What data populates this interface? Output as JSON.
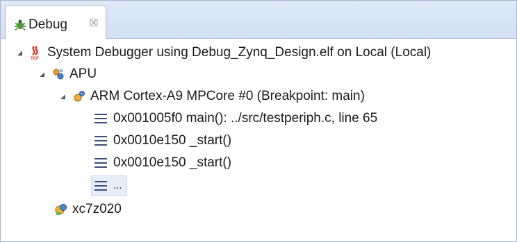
{
  "tab": {
    "label": "Debug",
    "close": "☒",
    "icon": "debug-icon"
  },
  "tree": {
    "session": {
      "label": "System Debugger using Debug_Zynq_Design.elf on Local (Local)",
      "icon": "tcf-session-icon"
    },
    "apu": {
      "label": "APU",
      "icon": "processor-group-icon"
    },
    "core": {
      "label": "ARM Cortex-A9 MPCore #0 (Breakpoint: main)",
      "icon": "suspended-core-icon"
    },
    "frames": [
      {
        "label": "0x001005f0 main(): ../src/testperiph.c, line 65"
      },
      {
        "label": "0x0010e150 _start()"
      },
      {
        "label": "0x0010e150 _start()"
      },
      {
        "label": "..."
      }
    ],
    "device": {
      "label": "xc7z020",
      "icon": "device-icon"
    }
  },
  "colors": {
    "tab_strip": "#d3e0f1",
    "border": "#a9b8cf",
    "frame_icon": "#3a4f7a"
  }
}
